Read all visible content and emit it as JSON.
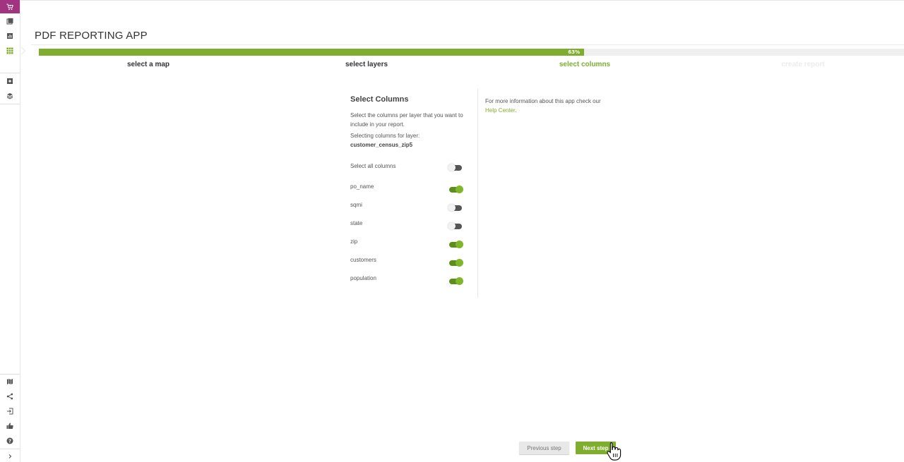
{
  "app": {
    "title": "PDF REPORTING APP"
  },
  "progress": {
    "percent": 63,
    "label": "63%"
  },
  "steps": [
    {
      "label": "select a map",
      "state": "done"
    },
    {
      "label": "select layers",
      "state": "done"
    },
    {
      "label": "select columns",
      "state": "current"
    },
    {
      "label": "create report",
      "state": "future"
    }
  ],
  "panel": {
    "heading": "Select Columns",
    "description": "Select the columns per layer that you want to include in your report.",
    "layer_label": "Selecting columns for layer:",
    "layer_name": "customer_census_zip5",
    "select_all_label": "Select all columns",
    "select_all": false,
    "columns": [
      {
        "name": "po_name",
        "enabled": true
      },
      {
        "name": "sqmi",
        "enabled": false
      },
      {
        "name": "state",
        "enabled": false
      },
      {
        "name": "zip",
        "enabled": true
      },
      {
        "name": "customers",
        "enabled": true
      },
      {
        "name": "population",
        "enabled": true
      }
    ]
  },
  "info": {
    "text": "For more information about this app check our",
    "link": "Help Center",
    "suffix": "."
  },
  "buttons": {
    "previous": "Previous step",
    "next": "Next step"
  },
  "sidebar": {
    "top_icons": [
      "cart-icon",
      "book-icon",
      "chart-icon",
      "grid-icon"
    ],
    "middle_icons": [
      "plus-icon",
      "layers-icon"
    ],
    "bottom_icons": [
      "map-icon",
      "share-icon",
      "login-icon",
      "thumbs-up-icon",
      "help-icon",
      "chevron-right-icon"
    ]
  },
  "colors": {
    "accent": "#7fae2e",
    "brand": "#a23380"
  }
}
